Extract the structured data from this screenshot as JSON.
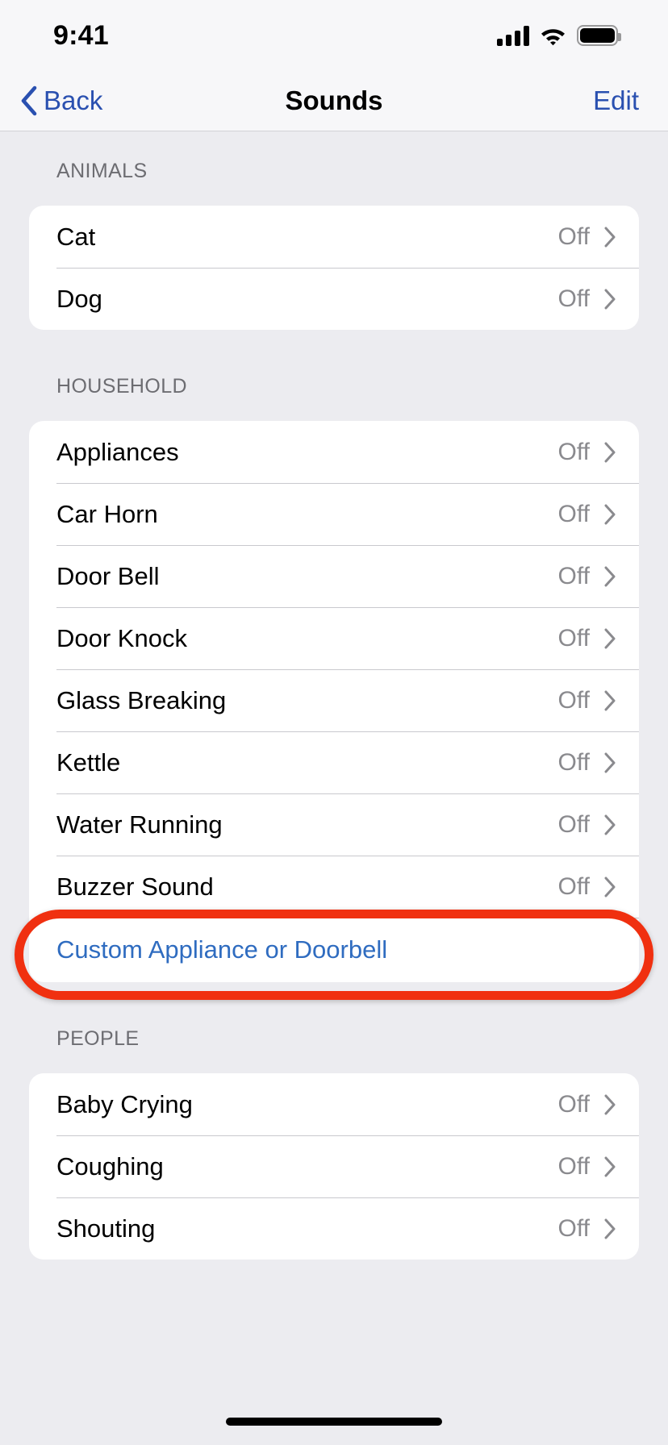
{
  "status_bar": {
    "time": "9:41",
    "cellular_icon": "cellular-signal-icon",
    "wifi_icon": "wifi-icon",
    "battery_icon": "battery-icon"
  },
  "nav": {
    "back_label": "Back",
    "back_icon": "chevron-left-icon",
    "title": "Sounds",
    "edit_label": "Edit"
  },
  "colors": {
    "accent_blue": "#2A50B0",
    "link_blue": "#2F6CC0",
    "annotation_red": "#F03010",
    "value_gray": "#8A8A8E",
    "page_background": "#ECECF0",
    "card_background": "#FFFFFF"
  },
  "annotation": {
    "shape": "rounded-rectangle-highlight",
    "target_row": "Buzzer Sound"
  },
  "sections": [
    {
      "header": "ANIMALS",
      "rows": [
        {
          "label": "Cat",
          "value": "Off",
          "accessory": "chevron-right-icon"
        },
        {
          "label": "Dog",
          "value": "Off",
          "accessory": "chevron-right-icon"
        }
      ]
    },
    {
      "header": "HOUSEHOLD",
      "rows": [
        {
          "label": "Appliances",
          "value": "Off",
          "accessory": "chevron-right-icon"
        },
        {
          "label": "Car Horn",
          "value": "Off",
          "accessory": "chevron-right-icon"
        },
        {
          "label": "Door Bell",
          "value": "Off",
          "accessory": "chevron-right-icon"
        },
        {
          "label": "Door Knock",
          "value": "Off",
          "accessory": "chevron-right-icon"
        },
        {
          "label": "Glass Breaking",
          "value": "Off",
          "accessory": "chevron-right-icon"
        },
        {
          "label": "Kettle",
          "value": "Off",
          "accessory": "chevron-right-icon"
        },
        {
          "label": "Water Running",
          "value": "Off",
          "accessory": "chevron-right-icon"
        },
        {
          "label": "Buzzer Sound",
          "value": "Off",
          "accessory": "chevron-right-icon",
          "highlighted": true
        },
        {
          "label": "Custom Appliance or Doorbell",
          "value": "",
          "accessory": "",
          "link": true
        }
      ]
    },
    {
      "header": "PEOPLE",
      "rows": [
        {
          "label": "Baby Crying",
          "value": "Off",
          "accessory": "chevron-right-icon"
        },
        {
          "label": "Coughing",
          "value": "Off",
          "accessory": "chevron-right-icon"
        },
        {
          "label": "Shouting",
          "value": "Off",
          "accessory": "chevron-right-icon"
        }
      ]
    }
  ]
}
